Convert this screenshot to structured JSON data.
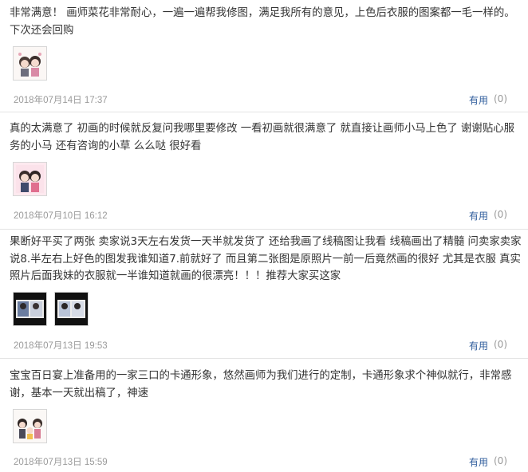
{
  "reviews": [
    {
      "text": "非常满意！ 画师菜花非常耐心，一遍一遍帮我修图，满足我所有的意见，上色后衣服的图案都一毛一样的。下次还会回购",
      "date": "2018年07月14日 17:37",
      "useful_label": "有用",
      "useful_count": "(0)"
    },
    {
      "text": "真的太满意了 初画的时候就反复问我哪里要修改 一看初画就很满意了 就直接让画师小马上色了 谢谢贴心服务的小马 还有咨询的小草 么么哒 很好看",
      "date": "2018年07月10日 16:12",
      "useful_label": "有用",
      "useful_count": "(0)"
    },
    {
      "text": "果断好平买了两张 卖家说3天左右发货一天半就发货了 还给我画了线稿图让我看 线稿画出了精髓 问卖家卖家说8.半左右上好色的图发我谁知道7.前就好了 而且第二张图是原照片一前一后竟然画的很好 尤其是衣服 真实照片后面我妹的衣服就一半谁知道就画的很漂亮！！！推荐大家买这家",
      "date": "2018年07月13日 19:53",
      "useful_label": "有用",
      "useful_count": "(0)"
    },
    {
      "text": "宝宝百日宴上准备用的一家三口的卡通形象，悠然画师为我们进行的定制，卡通形象求个神似就行，非常感谢，基本一天就出稿了，神速",
      "date": "2018年07月13日 15:59",
      "useful_label": "有用",
      "useful_count": "(0)"
    }
  ]
}
